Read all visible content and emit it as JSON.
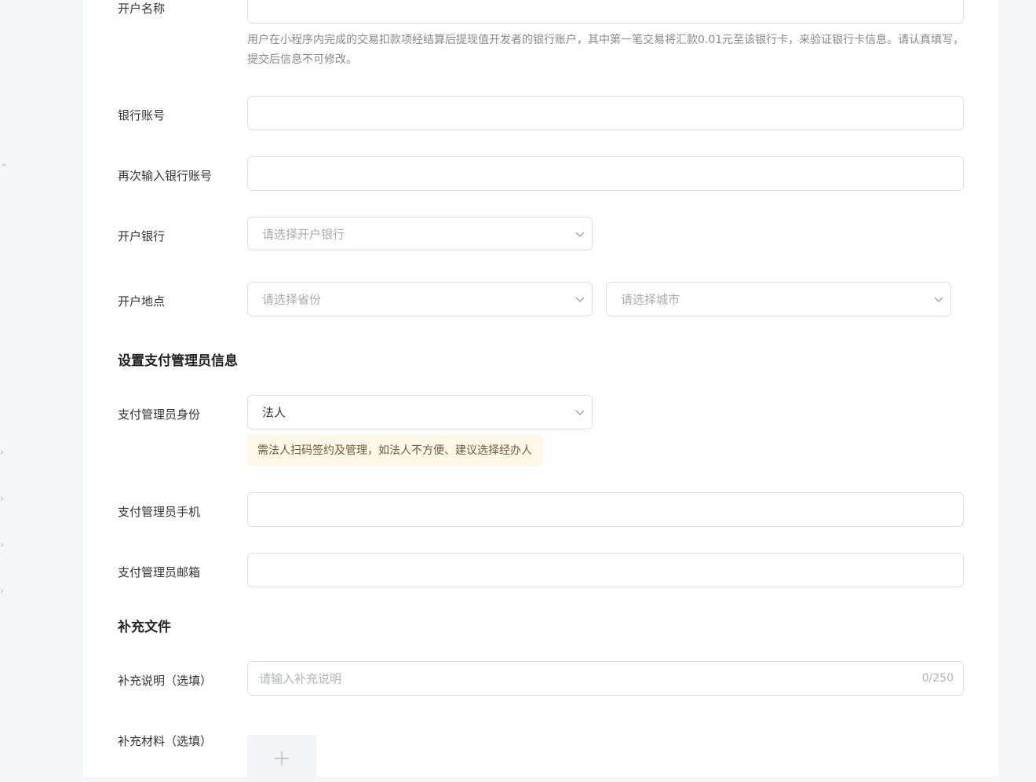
{
  "form": {
    "account_name": {
      "label": "开户名称",
      "hint": "用户在小程序内完成的交易扣款项经结算后提现值开发者的银行账户，其中第一笔交易将汇款0.01元至该银行卡，来验证银行卡信息。请认真填写，提交后信息不可修改。"
    },
    "bank_account": {
      "label": "银行账号"
    },
    "bank_account_confirm": {
      "label": "再次输入银行账号"
    },
    "bank": {
      "label": "开户银行",
      "placeholder": "请选择开户银行"
    },
    "location": {
      "label": "开户地点",
      "province_placeholder": "请选择省份",
      "city_placeholder": "请选择城市"
    }
  },
  "admin_section": {
    "title": "设置支付管理员信息",
    "identity": {
      "label": "支付管理员身份",
      "value": "法人",
      "warning": "需法人扫码签约及管理，如法人不方便、建议选择经办人"
    },
    "phone": {
      "label": "支付管理员手机"
    },
    "email": {
      "label": "支付管理员邮箱"
    }
  },
  "supplement_section": {
    "title": "补充文件",
    "note": {
      "label": "补充说明（选填）",
      "placeholder": "请输入补充说明",
      "counter": "0/250"
    },
    "materials": {
      "label": "补充材料（选填）"
    }
  },
  "colors": {
    "border": "#dcdfe6",
    "warning_bg": "#fff7e8",
    "placeholder": "#b0b3b8"
  }
}
